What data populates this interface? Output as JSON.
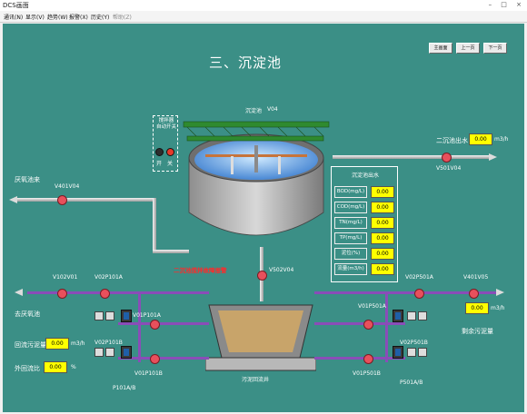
{
  "window": {
    "title": "DCS画面",
    "controls": "–  □  ×"
  },
  "menu": {
    "items": [
      "通讯(N)",
      "显示(V)",
      "趋势(W)",
      "报警(X)",
      "历史(Y)",
      "帮助(Z)"
    ]
  },
  "nav": {
    "home": "主画面",
    "prev": "上一页",
    "next": "下一页"
  },
  "page_title": "三、沉淀池",
  "tank": {
    "label": "沉淀池",
    "tag": "V04"
  },
  "mixer": {
    "title": "搅拌器\n自动开关",
    "on_label": "开",
    "off_label": "关"
  },
  "inlet": {
    "label": "厌氧池来",
    "valve": "V401V04"
  },
  "outlet": {
    "label": "二沉池出水",
    "value": "0.00",
    "unit": "m3/h",
    "valve": "V501V04"
  },
  "quality_panel": {
    "title": "沉淀池出水",
    "rows": [
      {
        "label": "BOD(mg/L)",
        "value": "0.00"
      },
      {
        "label": "COD(mg/L)",
        "value": "0.00"
      },
      {
        "label": "TN(mg/L)",
        "value": "0.00"
      },
      {
        "label": "TP(mg/L)",
        "value": "0.00"
      },
      {
        "label": "泥位(%)",
        "value": "0.00"
      },
      {
        "label": "流量(m3/h)",
        "value": "0.00"
      }
    ]
  },
  "status_text": "二沉池搅拌故障报警",
  "v502": "V502V04",
  "sludge_well": "污泥回流井",
  "left_group": {
    "to_anoxic": "去厌氧池",
    "v101": "V102V01",
    "v2p101a": "V02P101A",
    "v01p101a": "V01P101A",
    "v02p101b": "V02P101B",
    "v01p101b": "V01P101B",
    "pump_label": "P101A/B",
    "return_flow_label": "回流污泥量",
    "return_flow_value": "0.00",
    "return_flow_unit": "m3/h",
    "ext_ratio_label": "外回流比",
    "ext_ratio_value": "0.00",
    "ext_ratio_unit": "%"
  },
  "right_group": {
    "v2p501a": "V02P501A",
    "v401v05": "V401V05",
    "v01p501a": "V01P501A",
    "v02p501b": "V02P501B",
    "v01p501b": "V01P501B",
    "pump_label": "P501A/B",
    "excess_label": "剩余污泥量",
    "excess_value": "0.00",
    "excess_unit": "m3/h"
  },
  "colors": {
    "background": "#3b8f86",
    "value_bg": "#ffff00",
    "alarm": "#ff2a2a",
    "pipe_purple": "#8a4db8"
  }
}
